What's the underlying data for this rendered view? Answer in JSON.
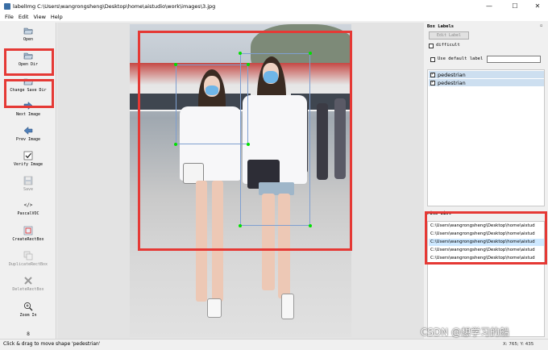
{
  "window": {
    "title": "labelImg C:\\Users\\wangrongsheng\\Desktop\\home\\aistudio\\work\\images\\3.jpg",
    "minimize_glyph": "—",
    "maximize_glyph": "☐",
    "close_glyph": "✕"
  },
  "menu": [
    "File",
    "Edit",
    "View",
    "Help"
  ],
  "toolbar": {
    "items": [
      {
        "label": "Open",
        "icon": "folder-icon",
        "enabled": true
      },
      {
        "label": "Open Dir",
        "icon": "folder-icon",
        "enabled": true
      },
      {
        "label": "Change Save Dir",
        "icon": "folder-icon",
        "enabled": true
      },
      {
        "label": "Next Image",
        "icon": "arrow-right-icon",
        "enabled": true
      },
      {
        "label": "Prev Image",
        "icon": "arrow-left-icon",
        "enabled": true
      },
      {
        "label": "Verify Image",
        "icon": "check-icon",
        "enabled": true
      },
      {
        "label": "Save",
        "icon": "save-icon",
        "enabled": false
      },
      {
        "label": "PascalVOC",
        "icon": "format-icon",
        "glyph": "</>",
        "enabled": true
      },
      {
        "label": "CreateRectBox",
        "icon": "create-box-icon",
        "enabled": true
      },
      {
        "label": "DuplicateRectBox",
        "icon": "duplicate-icon",
        "enabled": false
      },
      {
        "label": "DeleteRectBox",
        "icon": "delete-icon",
        "enabled": false
      },
      {
        "label": "Zoom In",
        "icon": "zoom-in-icon",
        "enabled": true
      },
      {
        "label": "",
        "icon": "more-icon",
        "glyph": "8",
        "enabled": true
      }
    ]
  },
  "box_labels": {
    "title": "Box Labels",
    "edit_label_button": "Edit Label",
    "difficult_label": "difficult",
    "use_default_label": "Use default label",
    "default_label_value": "",
    "labels": [
      {
        "text": "pedestrian",
        "checked": true
      },
      {
        "text": "pedestrian",
        "checked": true
      }
    ]
  },
  "file_list": {
    "title": "File List",
    "files": [
      "C:\\Users\\wangrongsheng\\Desktop\\home\\aistud",
      "C:\\Users\\wangrongsheng\\Desktop\\home\\aistud",
      "C:\\Users\\wangrongsheng\\Desktop\\home\\aistud",
      "C:\\Users\\wangrongsheng\\Desktop\\home\\aistud",
      "C:\\Users\\wangrongsheng\\Desktop\\home\\aistud"
    ],
    "selected_index": 2
  },
  "status": {
    "message": "Click & drag to move shape 'pedestrian'",
    "coords": "X: 765; Y: 435"
  },
  "watermark": "CSDN @想学习的船",
  "colors": {
    "highlight_red": "#e53935",
    "vertex_green": "#00e000",
    "box_blue": "#7f9fd0",
    "selection_blue": "#cddff0"
  }
}
